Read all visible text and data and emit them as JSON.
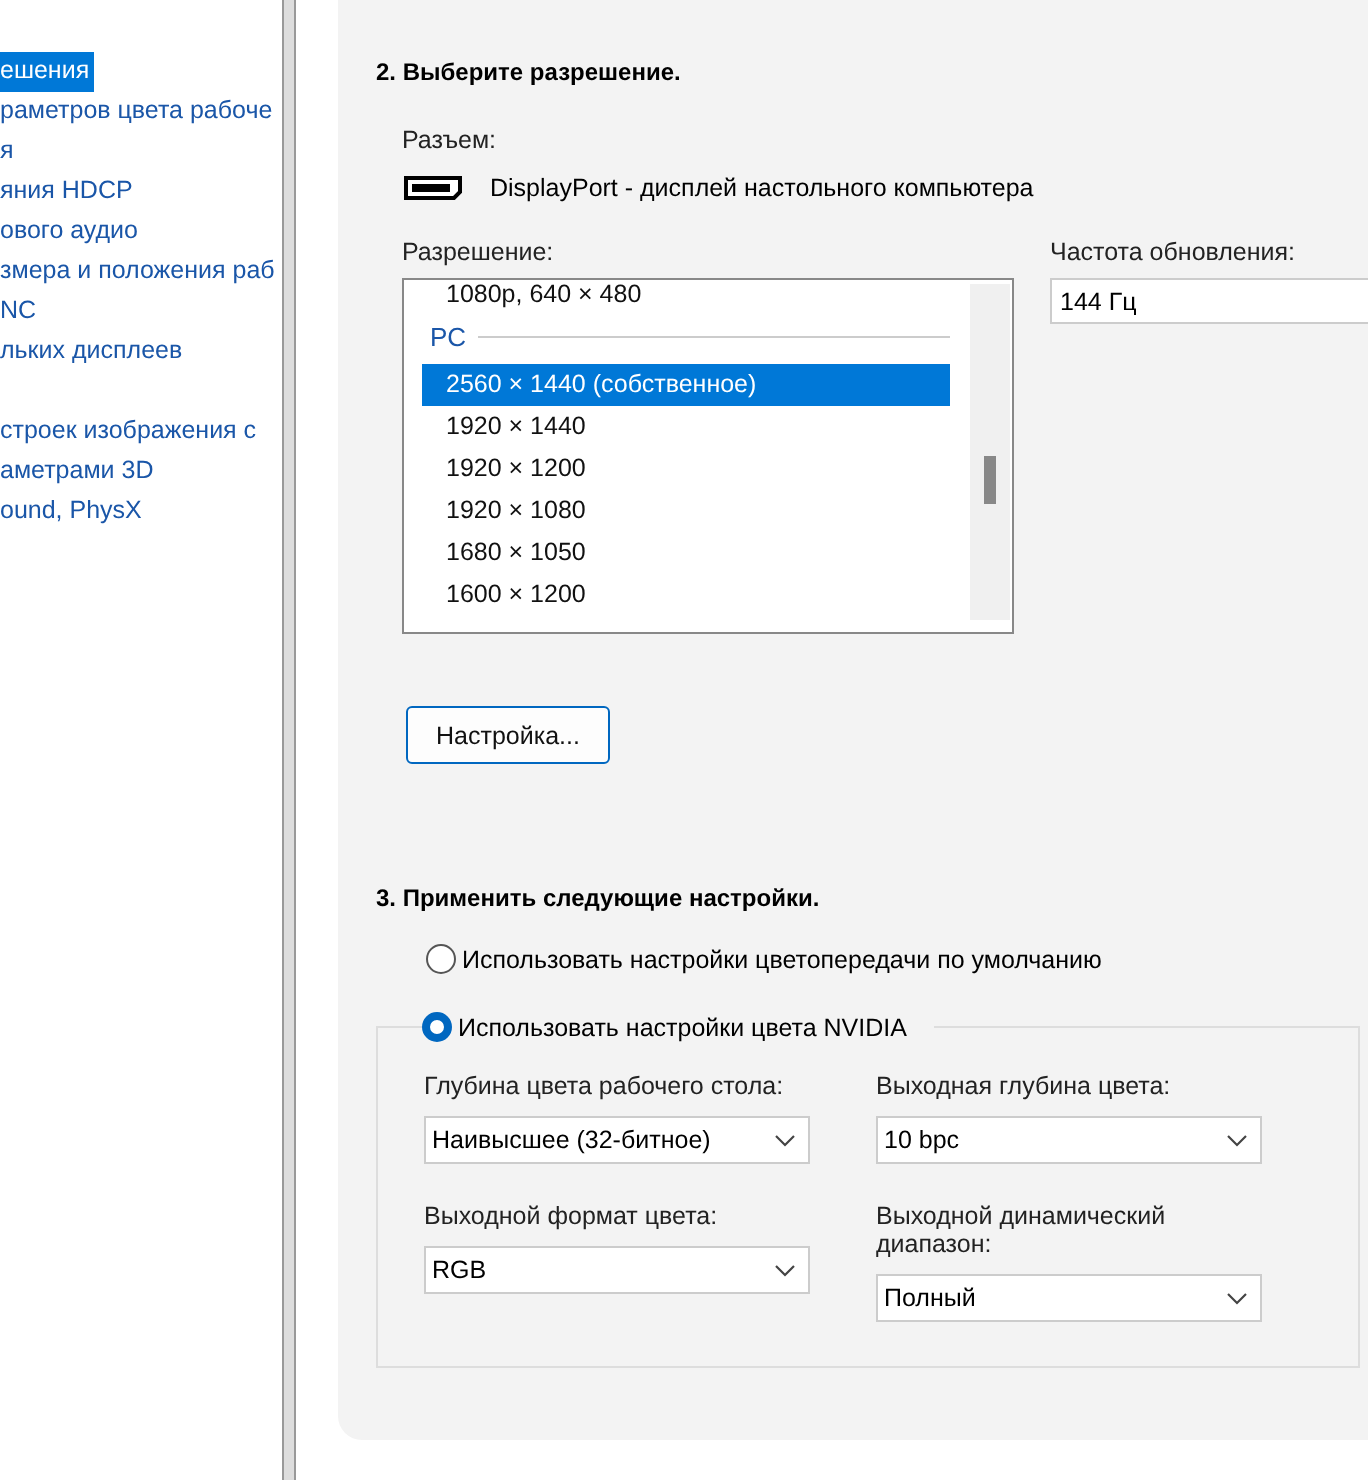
{
  "sidebar": {
    "groups": [
      {
        "items": [
          {
            "label": "ешения",
            "selected": true
          },
          {
            "label": "раметров цвета рабоче",
            "selected": false
          },
          {
            "label": "я",
            "selected": false
          },
          {
            "label": "яния HDCP",
            "selected": false
          },
          {
            "label": "ового аудио",
            "selected": false
          },
          {
            "label": "змера и положения раб",
            "selected": false
          },
          {
            "label": "NC",
            "selected": false
          },
          {
            "label": "льких дисплеев",
            "selected": false
          }
        ]
      },
      {
        "items": [
          {
            "label": "строек изображения с",
            "selected": false
          },
          {
            "label": "аметрами 3D",
            "selected": false
          },
          {
            "label": "ound, PhysX",
            "selected": false
          }
        ]
      }
    ]
  },
  "resolution_section": {
    "heading": "2. Выберите разрешение.",
    "connector_label": "Разъем:",
    "connector": "DisplayPort - дисплей настольного компьютера",
    "resolution_label": "Разрешение:",
    "list": [
      {
        "kind": "item",
        "label": "1080p, 640 × 480",
        "selected": false
      },
      {
        "kind": "group",
        "label": "PC"
      },
      {
        "kind": "item",
        "label": "2560 × 1440 (собственное)",
        "selected": true
      },
      {
        "kind": "item",
        "label": "1920 × 1440",
        "selected": false
      },
      {
        "kind": "item",
        "label": "1920 × 1200",
        "selected": false
      },
      {
        "kind": "item",
        "label": "1920 × 1080",
        "selected": false
      },
      {
        "kind": "item",
        "label": "1680 × 1050",
        "selected": false
      },
      {
        "kind": "item",
        "label": "1600 × 1200",
        "selected": false
      }
    ],
    "refresh_label": "Частота обновления:",
    "refresh_value": "144 Гц",
    "customize_button": "Настройка..."
  },
  "apply_section": {
    "heading": "3. Применить следующие настройки.",
    "options": [
      {
        "label": "Использовать настройки цветопередачи по умолчанию",
        "selected": false
      },
      {
        "label": "Использовать настройки цвета NVIDIA",
        "selected": true
      }
    ],
    "fields": [
      {
        "label": "Глубина цвета рабочего стола:",
        "value": "Наивысшее (32-битное)"
      },
      {
        "label": "Выходная глубина цвета:",
        "value": "10 bpc"
      },
      {
        "label": "Выходной формат цвета:",
        "value": "RGB"
      },
      {
        "label": "Выходной динамический диапазон:",
        "value": "Полный"
      }
    ]
  }
}
